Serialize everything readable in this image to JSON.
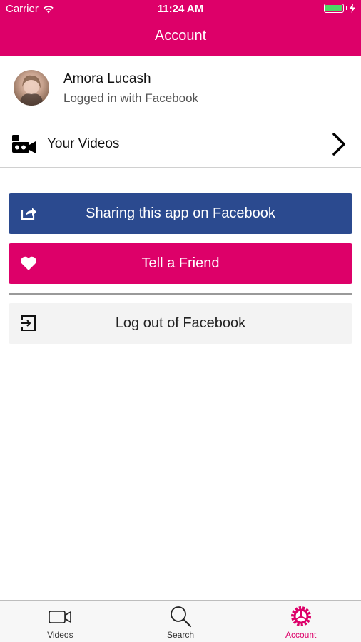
{
  "status_bar": {
    "carrier": "Carrier",
    "time": "11:24 AM"
  },
  "nav": {
    "title": "Account"
  },
  "profile": {
    "name": "Amora Lucash",
    "subtitle": "Logged in with Facebook"
  },
  "videos_row": {
    "label": "Your Videos",
    "icon": "video-camera-icon"
  },
  "actions": {
    "share_label": "Sharing this app on Facebook",
    "tell_label": "Tell a Friend",
    "logout_label": "Log out of Facebook"
  },
  "tabs": [
    {
      "label": "Videos",
      "icon": "video-icon",
      "active": false
    },
    {
      "label": "Search",
      "icon": "search-icon",
      "active": false
    },
    {
      "label": "Account",
      "icon": "account-gear-icon",
      "active": true
    }
  ],
  "colors": {
    "brand": "#dd0069",
    "facebook": "#2b4a8f",
    "battery": "#4cd964"
  }
}
